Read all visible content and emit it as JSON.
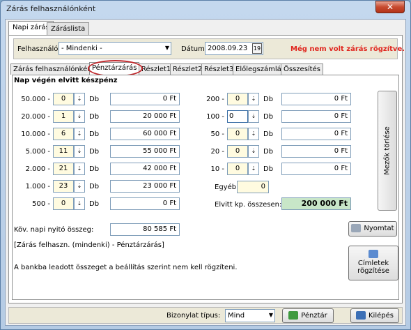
{
  "window": {
    "title": "Zárás felhasználónként",
    "close": "✕"
  },
  "top_tabs": [
    "Napi zárás",
    "Záráslista"
  ],
  "filter": {
    "user_label": "Felhasználó",
    "user_value": "- Mindenki -",
    "date_label": "Dátum",
    "date_value": "2008.09.23",
    "calendar_icon": "19",
    "warning": "Még nem volt zárás rögzítve."
  },
  "sub_tabs": [
    "Zárás felhasználónként",
    "Pénztárzárás",
    "Részlet1",
    "Részlet2",
    "Részlet3",
    "Előlegszámlák",
    "Összesítés"
  ],
  "section_title": "Nap végén elvitt készpénz",
  "unit": "Db",
  "spin_glyph": "⇣",
  "left_denoms": [
    {
      "label": "50.000 -",
      "count": "0",
      "amount": "0 Ft"
    },
    {
      "label": "20.000 -",
      "count": "1",
      "amount": "20 000 Ft"
    },
    {
      "label": "10.000 -",
      "count": "6",
      "amount": "60 000 Ft"
    },
    {
      "label": "5.000 -",
      "count": "11",
      "amount": "55 000 Ft"
    },
    {
      "label": "2.000 -",
      "count": "21",
      "amount": "42 000 Ft"
    },
    {
      "label": "1.000 -",
      "count": "23",
      "amount": "23 000 Ft"
    },
    {
      "label": "500 -",
      "count": "0",
      "amount": "0 Ft"
    }
  ],
  "right_denoms": [
    {
      "label": "200 -",
      "count": "0",
      "amount": "0 Ft"
    },
    {
      "label": "100 -",
      "count": "0",
      "amount": "0 Ft"
    },
    {
      "label": "50 -",
      "count": "0",
      "amount": "0 Ft"
    },
    {
      "label": "20 -",
      "count": "0",
      "amount": "0 Ft"
    },
    {
      "label": "10 -",
      "count": "0",
      "amount": "0 Ft"
    }
  ],
  "egyeb": {
    "label": "Egyéb:",
    "value": "0"
  },
  "total": {
    "label": "Elvitt kp. összesen:",
    "value": "200 000 Ft"
  },
  "clear_button": "Mezők törlése",
  "next_day": {
    "label": "Köv. napi nyitó összeg:",
    "value": "80 585 Ft"
  },
  "path_text": "[Zárás felhaszn. (mindenki) - Pénztárzárás]",
  "info_text": "A bankba leadott összeget a beállítás szerint nem kell rögzíteni.",
  "print_button": "Nyomtat",
  "cimletek_button": [
    "Címletek",
    "rögzítése"
  ],
  "bottom": {
    "doc_type_label": "Bizonylat típus:",
    "doc_type_value": "Mind",
    "penztar_button": "Pénztár",
    "exit_button": "Kilépés"
  },
  "colors": {
    "warning": "#e0261e",
    "highlight_ring": "#c1282c",
    "total_bg": "#c8e6c8",
    "count_bg": "#fffbe0"
  }
}
